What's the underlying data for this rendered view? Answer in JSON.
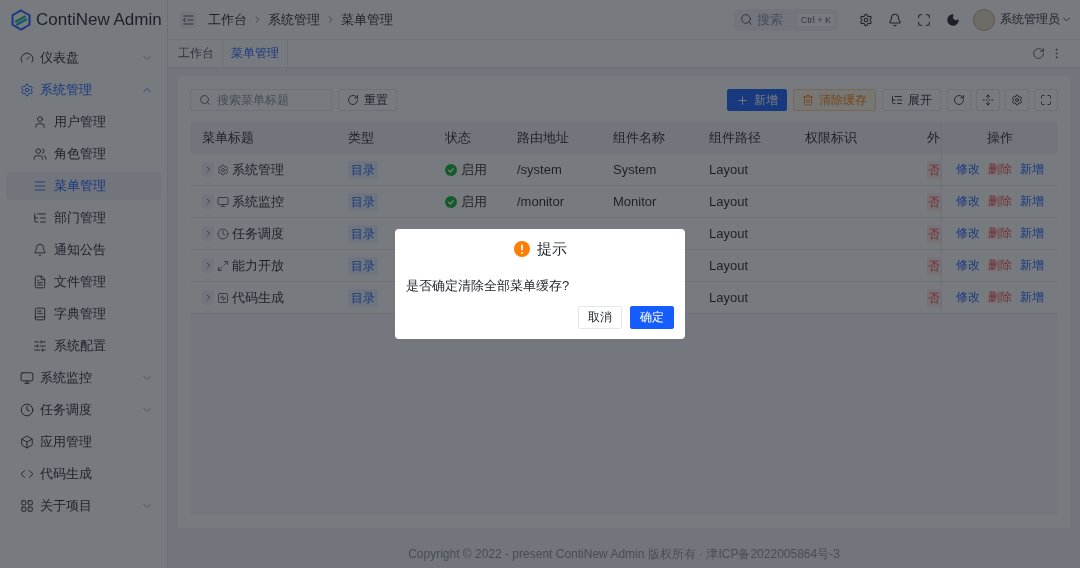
{
  "sidebar": {
    "logo": "ContiNew Admin",
    "items": [
      {
        "label": "仪表盘",
        "kind": "group",
        "expanded": false,
        "selected": false
      },
      {
        "label": "系统管理",
        "kind": "group",
        "expanded": true,
        "selected": true,
        "children": [
          {
            "label": "用户管理",
            "selected": false
          },
          {
            "label": "角色管理",
            "selected": false
          },
          {
            "label": "菜单管理",
            "selected": true
          },
          {
            "label": "部门管理",
            "selected": false
          },
          {
            "label": "通知公告",
            "selected": false
          },
          {
            "label": "文件管理",
            "selected": false
          },
          {
            "label": "字典管理",
            "selected": false
          },
          {
            "label": "系统配置",
            "selected": false
          }
        ]
      },
      {
        "label": "系统监控",
        "kind": "group",
        "expanded": false,
        "selected": false
      },
      {
        "label": "任务调度",
        "kind": "group",
        "expanded": false,
        "selected": false
      },
      {
        "label": "应用管理",
        "kind": "link",
        "selected": false
      },
      {
        "label": "代码生成",
        "kind": "link",
        "selected": false
      },
      {
        "label": "关于项目",
        "kind": "group",
        "expanded": false,
        "selected": false
      }
    ]
  },
  "header": {
    "breadcrumb": [
      "工作台",
      "系统管理",
      "菜单管理"
    ],
    "search": {
      "placeholder": "搜索",
      "shortcut": "Ctrl + K"
    },
    "user": {
      "name": "系统管理员"
    }
  },
  "tabs": [
    {
      "label": "工作台",
      "selected": false
    },
    {
      "label": "菜单管理",
      "selected": true
    }
  ],
  "toolbar": {
    "search": {
      "placeholder": "搜索菜单标题"
    },
    "left_buttons": [
      {
        "label": "重置",
        "kind": "default"
      }
    ],
    "right_buttons": [
      {
        "label": "新增",
        "kind": "primary"
      },
      {
        "label": "清除缓存",
        "kind": "warning"
      },
      {
        "label": "展开",
        "kind": "default"
      }
    ]
  },
  "table": {
    "columns": [
      "菜单标题",
      "类型",
      "状态",
      "路由地址",
      "组件名称",
      "组件路径",
      "权限标识",
      "外",
      "操作"
    ],
    "rows": [
      {
        "title": "系统管理",
        "expanded": false,
        "type": "目录",
        "status": "启用",
        "route": "/system",
        "component_name": "System",
        "component_path": "Layout",
        "external": "否",
        "actions": [
          {
            "label": "修改",
            "kind": "link"
          },
          {
            "label": "删除",
            "kind": "danger"
          },
          {
            "label": "新增",
            "kind": "link"
          }
        ]
      },
      {
        "title": "系统监控",
        "expanded": false,
        "type": "目录",
        "status": "启用",
        "route": "/monitor",
        "component_name": "Monitor",
        "component_path": "Layout",
        "external": "否",
        "actions": [
          {
            "label": "修改",
            "kind": "link"
          },
          {
            "label": "删除",
            "kind": "danger"
          },
          {
            "label": "新增",
            "kind": "link"
          }
        ]
      },
      {
        "title": "任务调度",
        "expanded": false,
        "type": "目录",
        "component_path": "Layout",
        "external": "否",
        "actions": [
          {
            "label": "修改",
            "kind": "link"
          },
          {
            "label": "删除",
            "kind": "danger"
          },
          {
            "label": "新增",
            "kind": "link"
          }
        ]
      },
      {
        "title": "能力开放",
        "expanded": false,
        "type": "目录",
        "component_path": "Layout",
        "external": "否",
        "actions": [
          {
            "label": "修改",
            "kind": "link"
          },
          {
            "label": "删除",
            "kind": "danger"
          },
          {
            "label": "新增",
            "kind": "link"
          }
        ]
      },
      {
        "title": "代码生成",
        "expanded": false,
        "type": "目录",
        "component_path": "Layout",
        "external": "否",
        "actions": [
          {
            "label": "修改",
            "kind": "link"
          },
          {
            "label": "删除",
            "kind": "danger"
          },
          {
            "label": "新增",
            "kind": "link"
          }
        ]
      }
    ]
  },
  "dialog": {
    "title": "提示",
    "message": "是否确定清除全部菜单缓存?",
    "buttons": [
      {
        "label": "取消",
        "kind": "default"
      },
      {
        "label": "确定",
        "kind": "primary"
      }
    ]
  },
  "footer": "Copyright © 2022 - present ContiNew Admin 版权所有 · 津ICP备2022005864号-3"
}
